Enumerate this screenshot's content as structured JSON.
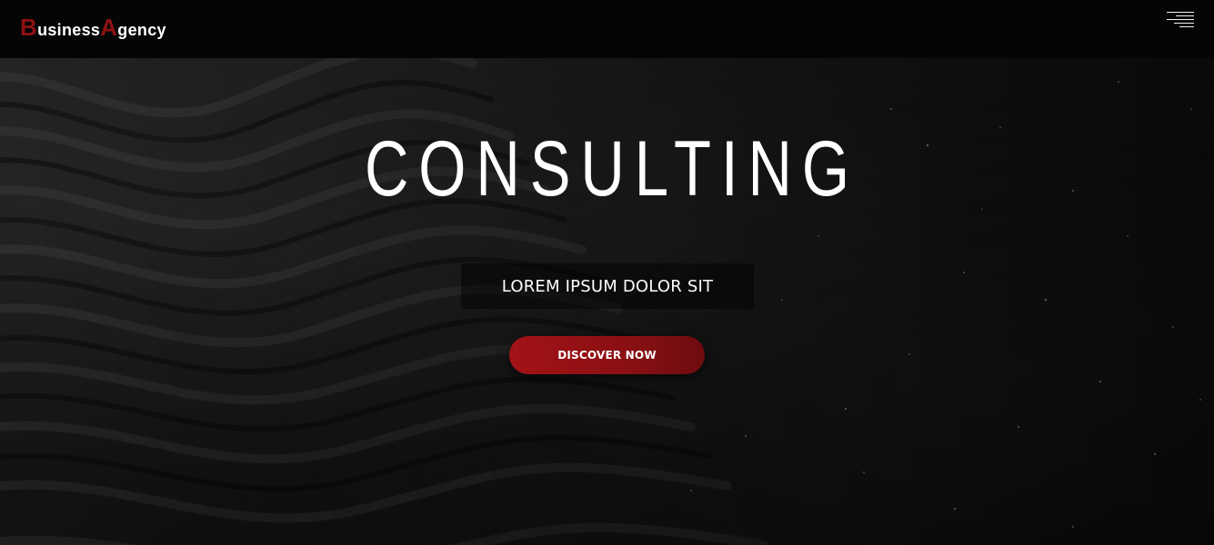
{
  "header": {
    "brand_first_initial": "B",
    "brand_first_rest": "usiness",
    "brand_second_initial": "A",
    "brand_second_rest": "gency",
    "menu_icon": "hamburger-menu-icon"
  },
  "hero": {
    "title": "CONSULTING",
    "tagline": "LOREM IPSUM DOLOR SIT",
    "cta_label": "DISCOVER NOW"
  },
  "colors": {
    "accent": "#8e1111",
    "button": "#9a1115",
    "topbar": "#050505"
  }
}
